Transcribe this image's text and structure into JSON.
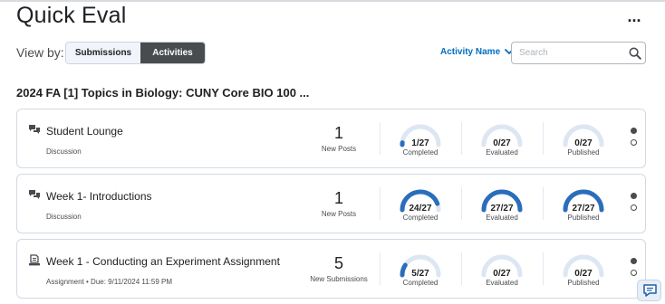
{
  "header": {
    "title": "Quick Eval",
    "more_label": "..."
  },
  "toolbar": {
    "view_by_label": "View by:",
    "view_by_options": [
      "Submissions",
      "Activities"
    ],
    "view_by_selected": "Activities",
    "sort_label": "Activity Name",
    "search_placeholder": "Search"
  },
  "course": {
    "title": "2024 FA [1] Topics in Biology: CUNY Core BIO 100 ..."
  },
  "activities": [
    {
      "name": "Student Lounge",
      "meta": "Discussion",
      "icon": "discussion-icon",
      "count": "1",
      "count_label": "New Posts",
      "gauges": [
        {
          "value": "1/27",
          "label": "Completed",
          "fraction": 0.037
        },
        {
          "value": "0/27",
          "label": "Evaluated",
          "fraction": 0
        },
        {
          "value": "0/27",
          "label": "Published",
          "fraction": 0
        }
      ]
    },
    {
      "name": "Week 1- Introductions",
      "meta": "Discussion",
      "icon": "discussion-icon",
      "count": "1",
      "count_label": "New Posts",
      "gauges": [
        {
          "value": "24/27",
          "label": "Completed",
          "fraction": 0.889
        },
        {
          "value": "27/27",
          "label": "Evaluated",
          "fraction": 1
        },
        {
          "value": "27/27",
          "label": "Published",
          "fraction": 1
        }
      ]
    },
    {
      "name": "Week 1 - Conducting an Experiment Assignment",
      "meta": "Assignment • Due: 9/11/2024 11:59 PM",
      "icon": "assignment-icon",
      "count": "5",
      "count_label": "New Submissions",
      "gauges": [
        {
          "value": "5/27",
          "label": "Completed",
          "fraction": 0.185
        },
        {
          "value": "0/27",
          "label": "Evaluated",
          "fraction": 0
        },
        {
          "value": "0/27",
          "label": "Published",
          "fraction": 0
        }
      ]
    }
  ],
  "colors": {
    "accent": "#006fbf",
    "gauge_fill": "#2a6ebb",
    "gauge_track": "#dde6f3",
    "selected_toggle": "#494c4e"
  }
}
